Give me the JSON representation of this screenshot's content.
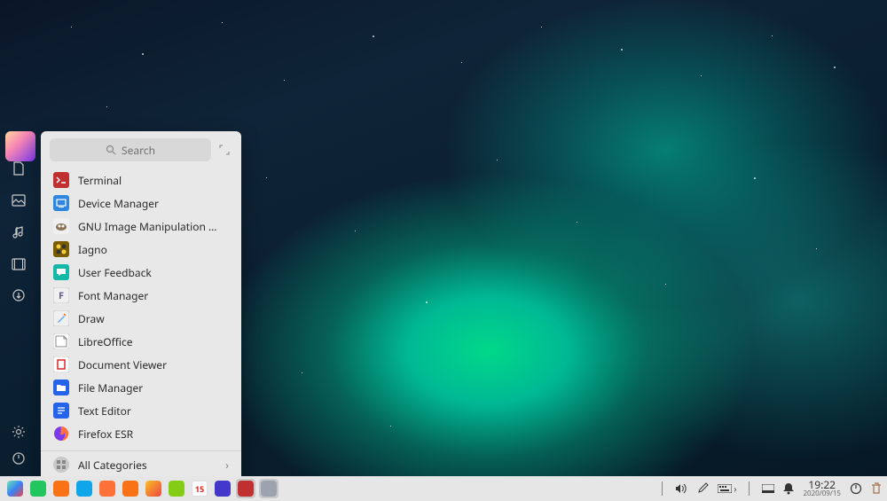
{
  "search": {
    "placeholder": "Search"
  },
  "apps": [
    {
      "label": "Terminal",
      "icon": "terminal",
      "bg": "#c03030"
    },
    {
      "label": "Device Manager",
      "icon": "device",
      "bg": "#2e86de"
    },
    {
      "label": "GNU Image Manipulation Pro...",
      "icon": "gimp",
      "bg": "#e8e8e8"
    },
    {
      "label": "Iagno",
      "icon": "iagno",
      "bg": "#7a5c00"
    },
    {
      "label": "User Feedback",
      "icon": "feedback",
      "bg": "#14b8a6"
    },
    {
      "label": "Font Manager",
      "icon": "font",
      "bg": "#f0f0f0"
    },
    {
      "label": "Draw",
      "icon": "draw",
      "bg": "#f0f0f0"
    },
    {
      "label": "LibreOffice",
      "icon": "libreoffice",
      "bg": "#f0f0f0"
    },
    {
      "label": "Document Viewer",
      "icon": "docviewer",
      "bg": "#f0f0f0"
    },
    {
      "label": "File Manager",
      "icon": "files",
      "bg": "#2563eb"
    },
    {
      "label": "Text Editor",
      "icon": "text",
      "bg": "#2563eb"
    },
    {
      "label": "Firefox ESR",
      "icon": "firefox",
      "bg": "#ff7139"
    }
  ],
  "all_categories": "All Categories",
  "left_rail": [
    {
      "name": "computer-icon"
    },
    {
      "name": "document-icon"
    },
    {
      "name": "image-icon"
    },
    {
      "name": "music-icon"
    },
    {
      "name": "video-icon"
    },
    {
      "name": "downloads-icon"
    }
  ],
  "left_rail_bottom": [
    {
      "name": "settings-icon"
    },
    {
      "name": "power-icon"
    }
  ],
  "taskbar_left": [
    {
      "name": "launcher-icon",
      "bg": "linear-gradient(135deg,#6ee7b7,#3b82f6,#ef4444)"
    },
    {
      "name": "multitask-icon",
      "bg": "#22c55e"
    },
    {
      "name": "workspace-icon",
      "bg": "#f97316"
    },
    {
      "name": "filemanager-icon",
      "bg": "#0ea5e9"
    },
    {
      "name": "firefox-icon",
      "bg": "#ff7139"
    },
    {
      "name": "appstore-icon",
      "bg": "#f97316"
    },
    {
      "name": "album-icon",
      "bg": "linear-gradient(135deg,#fbbf24,#ef4444)"
    },
    {
      "name": "music-icon",
      "bg": "#84cc16"
    },
    {
      "name": "calendar-icon",
      "bg": "#ffffff",
      "text": "15"
    },
    {
      "name": "system-icon",
      "bg": "#4338ca"
    },
    {
      "name": "terminal-task-icon",
      "bg": "#c03030",
      "active": true
    },
    {
      "name": "gimp-task-icon",
      "bg": "#9ca3af",
      "active": true
    }
  ],
  "tray": {
    "time": "19:22",
    "date": "2020/09/15"
  }
}
